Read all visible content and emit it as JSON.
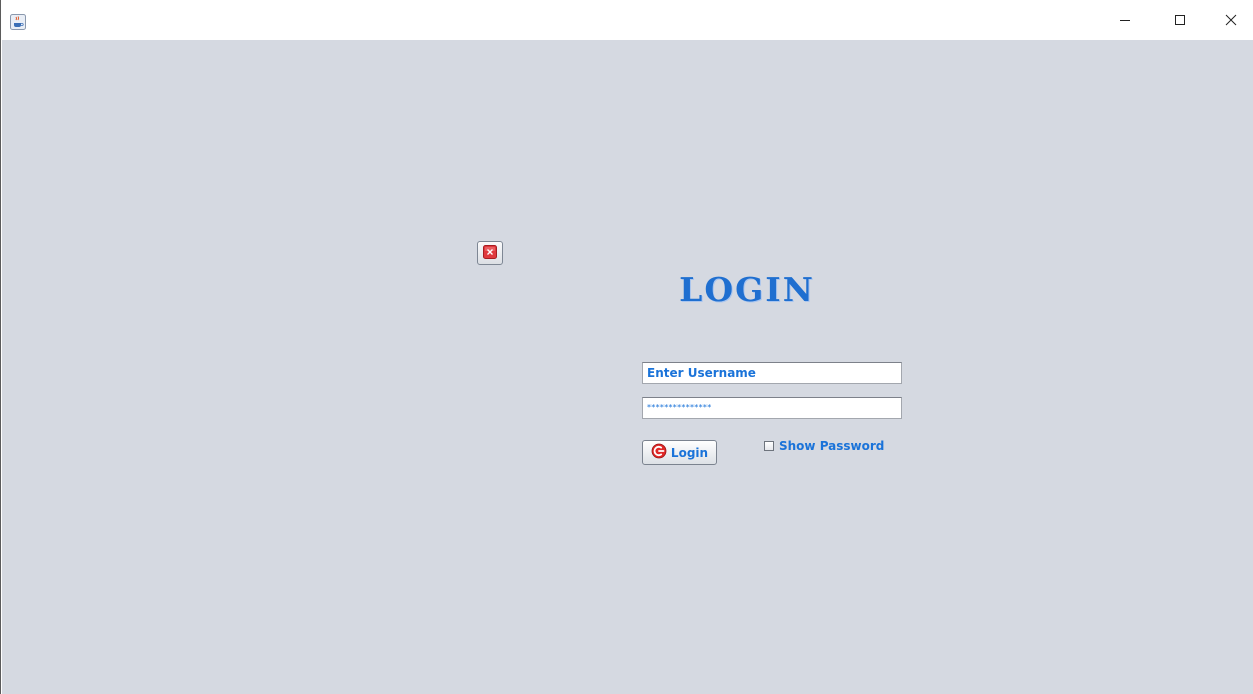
{
  "window": {
    "app_icon": "java-coffee-cup-icon",
    "controls": {
      "minimize_icon": "minimize-icon",
      "maximize_icon": "maximize-icon",
      "close_icon": "close-icon"
    }
  },
  "form": {
    "title": "LOGIN",
    "username": {
      "value": "Enter Username"
    },
    "password": {
      "value": "***************"
    },
    "login_button": {
      "label": "Login",
      "icon": "power-icon"
    },
    "show_password": {
      "label": "Show Password",
      "checked": false
    },
    "close_button_icon": "close-x-icon"
  },
  "colors": {
    "background": "#d5d9e1",
    "accent_text": "#1a73d9",
    "close_red": "#e0393e"
  }
}
